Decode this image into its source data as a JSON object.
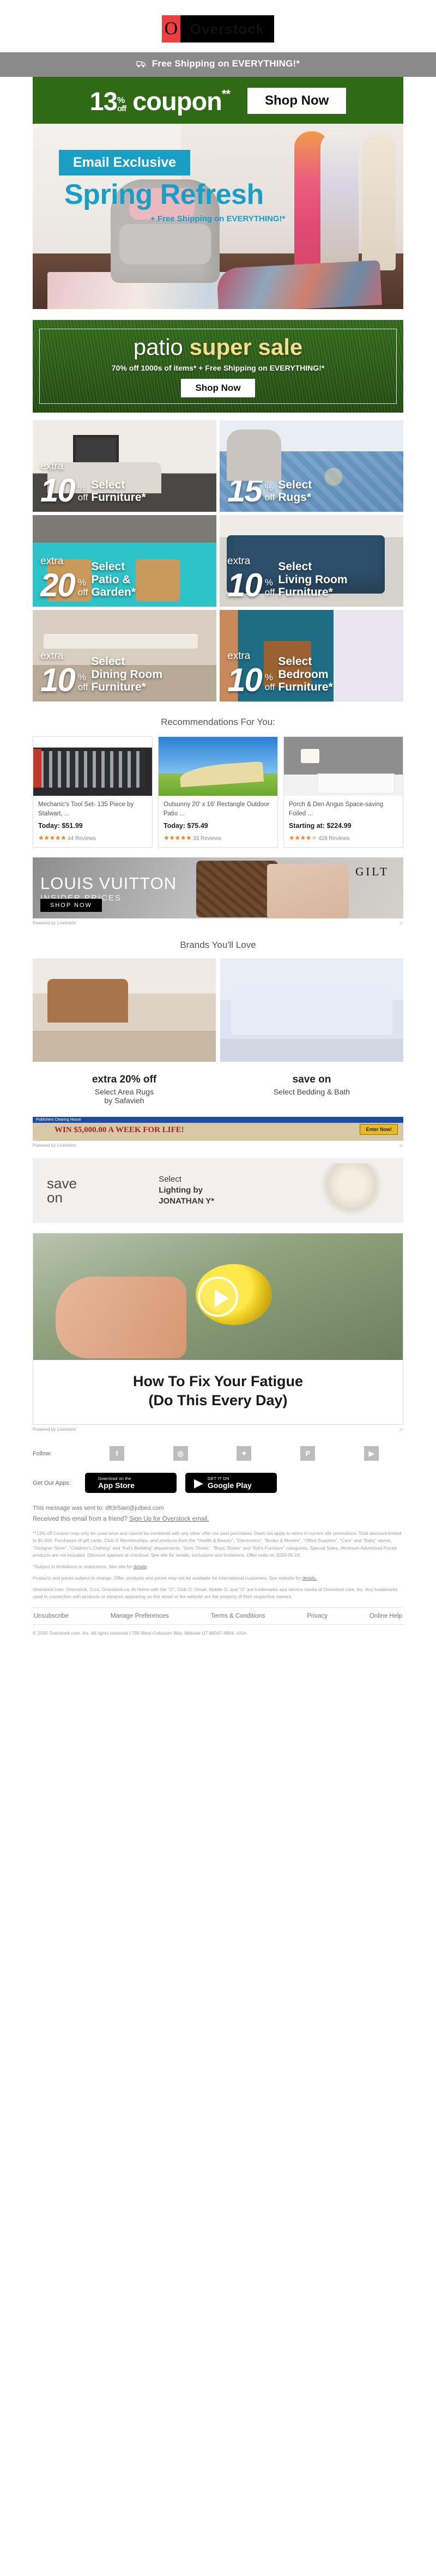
{
  "brand": {
    "logo_mark": "O",
    "logo_word": "Overstock"
  },
  "shipping_bar": {
    "text": "Free Shipping on EVERYTHING!*",
    "icon": "truck-icon"
  },
  "coupon": {
    "amount": "13",
    "percent": "%",
    "off": "off",
    "word": "coupon",
    "asterisks": "**",
    "cta": "Shop Now",
    "bg": "#2f6b14"
  },
  "hero": {
    "badge": "Email Exclusive",
    "title": "Spring Refresh",
    "subtitle": "+ Free Shipping on EVERYTHING!*",
    "accent": "#1a9ec4"
  },
  "patio": {
    "title_thin": "patio",
    "title_bold": "super sale",
    "sub": "70% off 1000s of items* + Free Shipping on EVERYTHING!*",
    "cta": "Shop Now",
    "accent": "#f2dd8f"
  },
  "tiles": [
    {
      "extra": "extra",
      "num": "10",
      "pct": "%",
      "off": "off",
      "l1": "Select",
      "l2": "Furniture*",
      "scene": "sc-furn"
    },
    {
      "extra": "extra",
      "num": "15",
      "pct": "%",
      "off": "off",
      "l1": "Select",
      "l2": "Rugs*",
      "scene": "sc-rugs"
    },
    {
      "extra": "extra",
      "num": "20",
      "pct": "%",
      "off": "off",
      "l1": "Select",
      "l2": "Patio &",
      "l3": "Garden*",
      "scene": "sc-patio"
    },
    {
      "extra": "extra",
      "num": "10",
      "pct": "%",
      "off": "off",
      "l1": "Select",
      "l2": "Living Room",
      "l3": "Furniture*",
      "scene": "sc-living"
    },
    {
      "extra": "extra",
      "num": "10",
      "pct": "%",
      "off": "off",
      "l1": "Select",
      "l2": "Dining Room",
      "l3": "Furniture*",
      "scene": "sc-dining"
    },
    {
      "extra": "extra",
      "num": "10",
      "pct": "%",
      "off": "off",
      "l1": "Select",
      "l2": "Bedroom",
      "l3": "Furniture*",
      "scene": "sc-bed"
    }
  ],
  "recommendations": {
    "heading": "Recommendations For You:",
    "items": [
      {
        "title": "Mechanic's Tool Set- 135 Piece by Stalwart, ...",
        "price": "Today: $51.99",
        "stars_full": "★★★★",
        "stars_half": "★",
        "stars_empty": "",
        "reviews": "44 Reviews",
        "img": "ri-tools"
      },
      {
        "title": "Outsunny 20' x 16' Rectangle Outdoor Patio ...",
        "price": "Today: $75.49",
        "stars_full": "★★★★",
        "stars_half": "★",
        "stars_empty": "",
        "reviews": "33 Reviews",
        "img": "ri-sail"
      },
      {
        "title": "Porch & Den Angus Space-saving Foiled ...",
        "price": "Starting at: $224.99",
        "stars_full": "★★★★",
        "stars_half": "",
        "stars_empty": "★",
        "reviews": "428 Reviews",
        "img": "ri-dress"
      }
    ]
  },
  "ad_gilt": {
    "brand": "LOUIS VUITTON",
    "sub": "INSIDER PRICES",
    "logo": "GILT",
    "cta": "SHOP NOW",
    "powered_by": "Powered by",
    "powered_name": "LiveIntent",
    "adchoices": "AdChoices"
  },
  "brands": {
    "heading": "Brands You'll Love",
    "items": [
      {
        "headline": "extra 20% off",
        "sub": "Select Area Rugs\nby Safavieh",
        "img": "bi-rug"
      },
      {
        "headline": "save on",
        "sub": "Select Bedding & Bath",
        "img": "bi-bed"
      }
    ]
  },
  "ad_pch": {
    "header": "Publishers Clearing House",
    "text": "WIN $5,000.00 A WEEK FOR LIFE!",
    "cta": "Enter Now!",
    "powered_by": "Powered by",
    "powered_name": "LiveIntent",
    "adchoices": "AdChoices"
  },
  "ad_jonathan": {
    "save": "save",
    "on": "on",
    "line1": "Select",
    "line2": "Lighting by",
    "line3": "JONATHAN Y*"
  },
  "video": {
    "title_line1": "How To Fix Your Fatigue",
    "title_line2": "(Do This Every Day)",
    "play_icon": "play-icon",
    "powered_by": "Powered by",
    "powered_name": "LiveIntent",
    "adchoices": "AdChoices"
  },
  "footer": {
    "follow_label": "Follow:",
    "social": [
      {
        "name": "facebook-icon",
        "glyph": "f"
      },
      {
        "name": "instagram-icon",
        "glyph": "◎"
      },
      {
        "name": "twitter-icon",
        "glyph": "✦"
      },
      {
        "name": "pinterest-icon",
        "glyph": "P"
      },
      {
        "name": "youtube-icon",
        "glyph": "▶"
      }
    ],
    "apps_label": "Get Our Apps:",
    "app_store": {
      "pre": "Download on the",
      "name": "App Store",
      "icon": "apple-icon"
    },
    "google_play": {
      "pre": "GET IT ON",
      "name": "Google Play",
      "icon": "play-store-icon"
    },
    "message_text": "This message was sent to: dft3r5ael@julbed.com",
    "friend_text": "Received this email from a friend? ",
    "friend_link": "Sign Up for Overstock email.",
    "legal_1": "**13% off Coupon may only be used once and cannot be combined with any other offer nor past purchases. Does not apply to items in current site promotions. Total discount limited to $5,000. Purchases of gift cards, Club O Memberships, and products from the “Health & Beauty”, “Electronics”, “Books & Movies”, “Office Supplies”, “Cars” and “Baby” stores, “Designer Store”, “Children’s Clothing” and “Kid’s Bedding” departments, “Girls’ Shoes”, “Boys’ Shoes” and “Kid’s Furniture” categories, Special Sales, Minimum Advertised Priced products are not included. Discount appears at checkout. See site for details, exclusions and limitations. Offer ends on 2020-05-10.",
    "legal_2_pre": "*Subject to limitations or restrictions. See site for ",
    "legal_2_link": "details",
    "legal_3_pre": "Products and prices subject to change. Offer, products and prices may not be available for international customers. See website for ",
    "legal_3_link": "details.",
    "legal_4": "Overstock.com, Overstock, O.co, Overstock.ca, At Home with the “O”, Club O, Omail, Mobile O, and “O” are trademarks and service marks of Overstock.com, Inc. Any trademarks used in connection with products or services appearing on this email or the website are the property of their respective owners.",
    "links": [
      "Unsubscribe",
      "Manage Preferences",
      "Terms & Conditions",
      "Privacy",
      "Online Help"
    ],
    "copyright": "© 2020 Overstock.com, Inc. All rights reserved | 799 West Coliseum Way, Midvale UT 84047-4804, USA"
  }
}
